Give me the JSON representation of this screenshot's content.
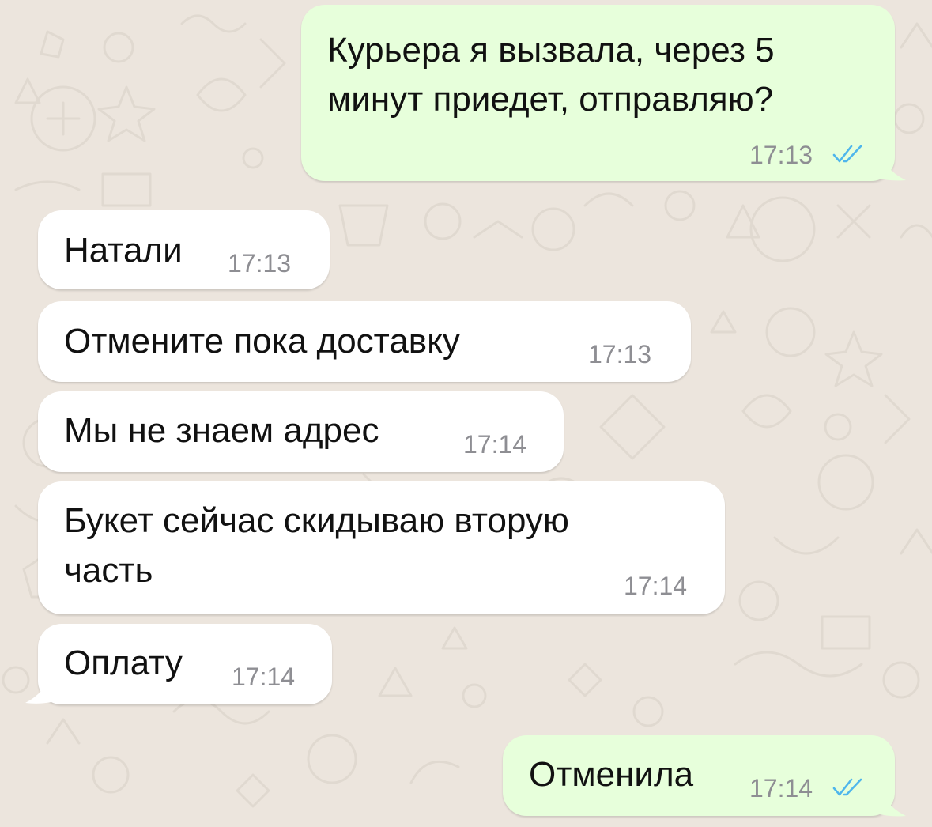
{
  "colors": {
    "wallpaper": "#ECE5DD",
    "incoming_bubble": "#FFFFFF",
    "outgoing_bubble": "#E7FFDB",
    "text": "#111111",
    "timestamp": "#8E8E93",
    "read_ticks": "#4FB6EC"
  },
  "messages": [
    {
      "direction": "outgoing",
      "lines": [
        "Курьера я вызвала, через 5",
        "минут приедет, отправляю?"
      ],
      "time": "17:13",
      "status": "read",
      "status_icon": "double-check-icon"
    },
    {
      "direction": "incoming",
      "lines": [
        "Натали"
      ],
      "time": "17:13"
    },
    {
      "direction": "incoming",
      "lines": [
        "Отмените пока доставку"
      ],
      "time": "17:13"
    },
    {
      "direction": "incoming",
      "lines": [
        "Мы не знаем адрес"
      ],
      "time": "17:14"
    },
    {
      "direction": "incoming",
      "lines": [
        "Букет сейчас скидываю вторую",
        "часть"
      ],
      "time": "17:14"
    },
    {
      "direction": "incoming",
      "lines": [
        "Оплату"
      ],
      "time": "17:14"
    },
    {
      "direction": "outgoing",
      "lines": [
        "Отменила"
      ],
      "time": "17:14",
      "status": "read",
      "status_icon": "double-check-icon"
    }
  ]
}
